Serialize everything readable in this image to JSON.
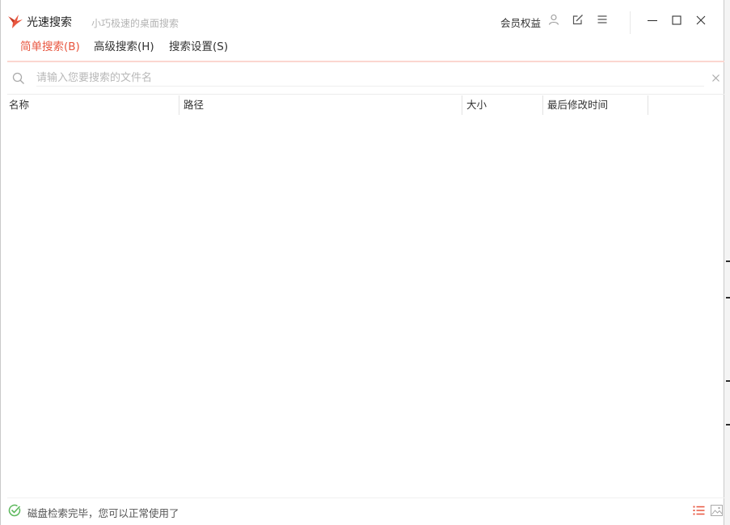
{
  "app": {
    "title": "光速搜索",
    "subtitle": "小巧极速的桌面搜索",
    "logo_icon": "bird-logo-icon"
  },
  "titlebar": {
    "member_label": "会员权益",
    "icons": [
      "user-icon",
      "edit-icon",
      "menu-icon",
      "minimize-icon",
      "maximize-icon",
      "close-icon"
    ]
  },
  "tabs": [
    {
      "label": "简单搜索(B)",
      "active": true
    },
    {
      "label": "高级搜索(H)",
      "active": false
    },
    {
      "label": "搜索设置(S)",
      "active": false
    }
  ],
  "search": {
    "placeholder": "请输入您要搜索的文件名",
    "value": "",
    "icon": "search-icon",
    "clear_icon": "clear-icon"
  },
  "table": {
    "columns": [
      "名称",
      "路径",
      "大小",
      "最后修改时间"
    ],
    "rows": []
  },
  "status": {
    "text": "磁盘检索完毕，您可以正常使用了",
    "icon": "check-circle-icon",
    "view_icons": [
      "list-view-icon",
      "image-view-icon"
    ]
  },
  "colors": {
    "accent": "#e8563f",
    "status_ok": "#5cb85c"
  }
}
